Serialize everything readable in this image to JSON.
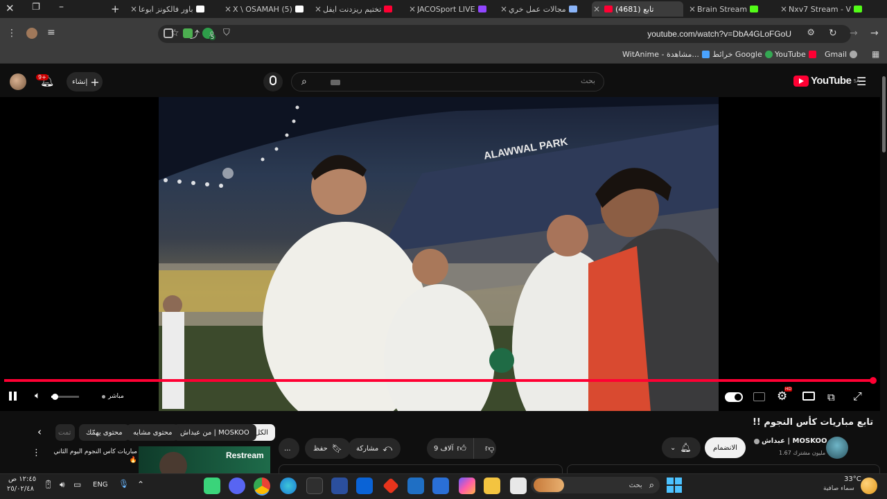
{
  "browser": {
    "tabs": [
      {
        "label": "Nxv7 Stream - V",
        "color": "#53fc18"
      },
      {
        "label": "Brain Stream",
        "color": "#53fc18"
      },
      {
        "label": "(4681) تابع",
        "color": "#ff0033",
        "active": true
      },
      {
        "label": "مجالات عمل خري",
        "color": "#8ab4f8"
      },
      {
        "label": "JACOSport LIVE",
        "color": "#9146ff"
      },
      {
        "label": "تختيم ريزدنت ايفل",
        "color": "#ff0033"
      },
      {
        "label": "X \\ OSAMAH (5)",
        "color": "#ffffff"
      },
      {
        "label": "باور فالكونز ابوعا",
        "color": "#ffffff"
      }
    ],
    "new_tab_label": "+",
    "url": "youtube.com/watch?v=DbA4GLoFGoU",
    "bookmarks": [
      {
        "label": "Gmail",
        "color": "#ea4335"
      },
      {
        "label": "YouTube",
        "color": "#ff0033"
      },
      {
        "label": "خرائط Google",
        "color": "#34a853"
      },
      {
        "label": "WitAnime - مشاهدة...",
        "color": "#4285f4"
      }
    ],
    "extension_badge": "5"
  },
  "youtube": {
    "logo_text": "YouTube",
    "region": "SA",
    "search_placeholder": "بحث",
    "create_label": "إنشاء",
    "notifications_count": "9+",
    "video": {
      "scene_sign": "ALAWWAL PARK",
      "live_label": "مباشر",
      "progress_fraction": 1.0,
      "volume_fraction": 0.12,
      "settings_badge": "HD"
    },
    "title": "تابع مباريات كأس النجوم !!",
    "channel_name": "عبداش | MOSKOO",
    "subscribers": "1.67 مليون مشترك",
    "join_label": "الانضمام",
    "likes": "9 آلاف",
    "share_label": "مشاركة",
    "save_label": "حفظ",
    "more_label": "...",
    "chips": [
      "الكل",
      "من عبداش | MOSKOO",
      "محتوى مشابه",
      "محتوى يهمّك",
      "تمت"
    ],
    "related": {
      "title": "مباريات كأس النجوم اليوم الثاني 🔥",
      "thumb_text": "Restream"
    }
  },
  "taskbar": {
    "weather_temp": "33°C",
    "weather_desc": "سماء صافية",
    "search_label": "بحث",
    "language": "ENG",
    "time": "١٢:٤٥ ص",
    "date": "٢٥/٠٢/٤٨"
  }
}
